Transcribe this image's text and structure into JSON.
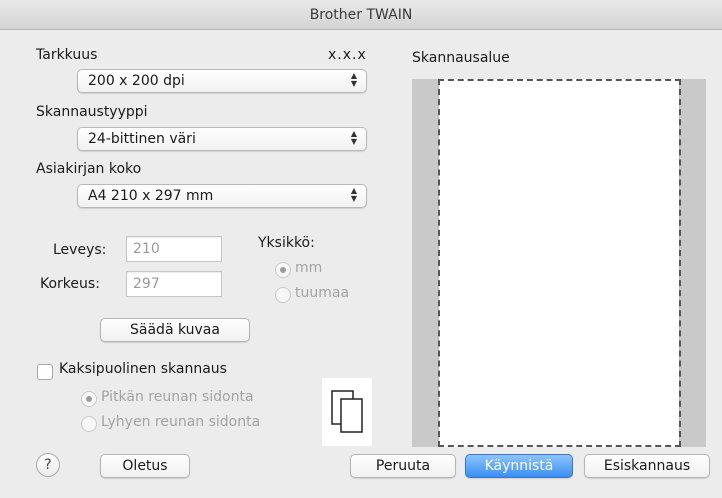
{
  "window": {
    "title": "Brother TWAIN"
  },
  "resolution": {
    "label": "Tarkkuus",
    "version": "x.x.x",
    "selected": "200 x 200 dpi"
  },
  "scan_type": {
    "label": "Skannaustyyppi",
    "selected": "24-bittinen väri"
  },
  "document_size": {
    "label": "Asiakirjan koko",
    "selected": "A4  210 x 297 mm"
  },
  "dimensions": {
    "width_label": "Leveys:",
    "width_value": "210",
    "height_label": "Korkeus:",
    "height_value": "297"
  },
  "unit": {
    "label": "Yksikkö:",
    "options": [
      "mm",
      "tuumaa"
    ],
    "selected": "mm"
  },
  "adjust_image_button": "Säädä kuvaa",
  "duplex": {
    "label": "Kaksipuolinen skannaus",
    "checked": false,
    "options": [
      "Pitkän reunan sidonta",
      "Lyhyen reunan sidonta"
    ],
    "selected": "Pitkän reunan sidonta"
  },
  "scan_area": {
    "label": "Skannausalue"
  },
  "footer": {
    "help_symbol": "?",
    "default_button": "Oletus",
    "cancel_button": "Peruuta",
    "start_button": "Käynnistä",
    "prescan_button": "Esiskannaus"
  },
  "icons": {
    "popup_arrows": "up-down-chevron-icon",
    "duplex": "two-pages-icon",
    "help": "help-icon"
  },
  "colors": {
    "default_button": "#3a8ff5",
    "preview_background": "#c9c9c9"
  }
}
